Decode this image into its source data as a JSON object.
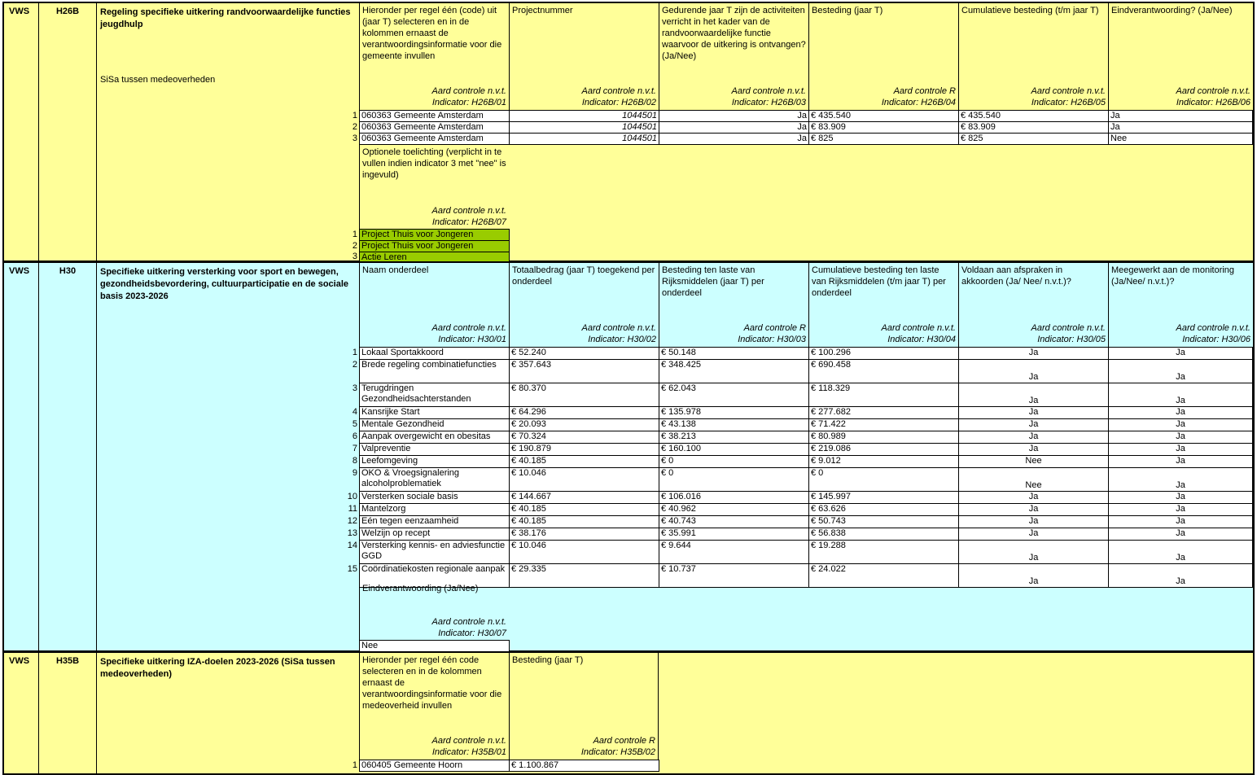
{
  "h26b": {
    "dept": "VWS",
    "code": "H26B",
    "title": "Regeling specifieke uitkering randvoorwaardelijke functies jeugdhulp",
    "subtitle": "SiSa tussen medeoverheden",
    "headers": [
      {
        "text": "Hieronder per regel één (code) uit (jaar T) selecteren en in de kolommen ernaast de verantwoordingsinformatie voor die gemeente invullen",
        "control": "Aard controle n.v.t.",
        "indicator": "Indicator: H26B/01"
      },
      {
        "text": "Projectnummer",
        "control": "Aard controle n.v.t.",
        "indicator": "Indicator: H26B/02"
      },
      {
        "text": "Gedurende jaar T zijn de activiteiten verricht in het kader van de randvoorwaardelijke functie waarvoor de uitkering is ontvangen? (Ja/Nee)",
        "control": "Aard controle n.v.t.",
        "indicator": "Indicator: H26B/03"
      },
      {
        "text": "Besteding (jaar T)",
        "control": "Aard controle R",
        "indicator": "Indicator: H26B/04"
      },
      {
        "text": "Cumulatieve besteding (t/m jaar T)",
        "control": "Aard controle n.v.t.",
        "indicator": "Indicator: H26B/05"
      },
      {
        "text": "Eindverantwoording? (Ja/Nee)",
        "control": "Aard controle n.v.t.",
        "indicator": "Indicator: H26B/06"
      }
    ],
    "rows": [
      {
        "n": "1",
        "gemeente": "060363 Gemeente Amsterdam",
        "project": "1044501",
        "activ": "Ja",
        "besteding": "€ 435.540",
        "cumulatief": "€ 435.540",
        "eind": "Ja"
      },
      {
        "n": "2",
        "gemeente": "060363 Gemeente Amsterdam",
        "project": "1044501",
        "activ": "Ja",
        "besteding": "€ 83.909",
        "cumulatief": "€ 83.909",
        "eind": "Ja"
      },
      {
        "n": "3",
        "gemeente": "060363 Gemeente Amsterdam",
        "project": "1044501",
        "activ": "Ja",
        "besteding": "€ 825",
        "cumulatief": "€ 825",
        "eind": "Nee"
      }
    ],
    "toelichting": {
      "text": "Optionele toelichting (verplicht in te vullen indien indicator 3 met \"nee\" is ingevuld)",
      "control": "Aard controle n.v.t.",
      "indicator": "Indicator: H26B/07"
    },
    "toelichting_rows": [
      {
        "n": "1",
        "text": "Project Thuis voor Jongeren"
      },
      {
        "n": "2",
        "text": "Project Thuis voor Jongeren"
      },
      {
        "n": "3",
        "text": "Actie Leren"
      }
    ]
  },
  "h30": {
    "dept": "VWS",
    "code": "H30",
    "title": "Specifieke uitkering versterking voor sport en bewegen, gezondheidsbevordering, cultuurparticipatie en de sociale basis 2023-2026",
    "headers": [
      {
        "text": "Naam onderdeel",
        "control": "Aard controle n.v.t.",
        "indicator": "Indicator: H30/01"
      },
      {
        "text": "Totaalbedrag (jaar T) toegekend per onderdeel",
        "control": "Aard controle n.v.t.",
        "indicator": "Indicator: H30/02"
      },
      {
        "text": "Besteding ten laste van Rijksmiddelen (jaar T) per onderdeel",
        "control": "Aard controle R",
        "indicator": "Indicator: H30/03"
      },
      {
        "text": "Cumulatieve besteding ten laste van Rijksmiddelen (t/m jaar T) per onderdeel",
        "control": "Aard controle n.v.t.",
        "indicator": "Indicator: H30/04"
      },
      {
        "text": "Voldaan aan afspraken in akkoorden (Ja/ Nee/ n.v.t.)?",
        "control": "Aard controle n.v.t.",
        "indicator": "Indicator: H30/05"
      },
      {
        "text": "Meegewerkt aan de monitoring (Ja/Nee/ n.v.t.)?",
        "control": "Aard controle n.v.t.",
        "indicator": "Indicator: H30/06"
      }
    ],
    "rows": [
      {
        "n": "1",
        "naam": "Lokaal Sportakkoord",
        "totaal": "€ 52.240",
        "besteding": "€ 50.148",
        "cumulatief": "€ 100.296",
        "voldaan": "Ja",
        "monitoring": "Ja"
      },
      {
        "n": "2",
        "naam": "Brede regeling combinatiefuncties",
        "totaal": "€ 357.643",
        "besteding": "€ 348.425",
        "cumulatief": "€ 690.458",
        "voldaan": "Ja",
        "monitoring": "Ja"
      },
      {
        "n": "3",
        "naam": "Terugdringen Gezondheidsachterstanden",
        "totaal": "€ 80.370",
        "besteding": "€ 62.043",
        "cumulatief": "€ 118.329",
        "voldaan": "Ja",
        "monitoring": "Ja"
      },
      {
        "n": "4",
        "naam": "Kansrijke Start",
        "totaal": "€ 64.296",
        "besteding": "€ 135.978",
        "cumulatief": "€ 277.682",
        "voldaan": "Ja",
        "monitoring": "Ja"
      },
      {
        "n": "5",
        "naam": "Mentale Gezondheid",
        "totaal": "€ 20.093",
        "besteding": "€ 43.138",
        "cumulatief": "€ 71.422",
        "voldaan": "Ja",
        "monitoring": "Ja"
      },
      {
        "n": "6",
        "naam": "Aanpak overgewicht en obesitas",
        "totaal": "€ 70.324",
        "besteding": "€ 38.213",
        "cumulatief": "€ 80.989",
        "voldaan": "Ja",
        "monitoring": "Ja"
      },
      {
        "n": "7",
        "naam": "Valpreventie",
        "totaal": "€ 190.879",
        "besteding": "€ 160.100",
        "cumulatief": "€ 219.086",
        "voldaan": "Ja",
        "monitoring": "Ja"
      },
      {
        "n": "8",
        "naam": "Leefomgeving",
        "totaal": "€ 40.185",
        "besteding": "€ 0",
        "cumulatief": "€ 9.012",
        "voldaan": "Nee",
        "monitoring": "Ja"
      },
      {
        "n": "9",
        "naam": "OKO & Vroegsignalering alcoholproblematiek",
        "totaal": "€ 10.046",
        "besteding": "€ 0",
        "cumulatief": "€ 0",
        "voldaan": "Nee",
        "monitoring": "Ja"
      },
      {
        "n": "10",
        "naam": "Versterken sociale basis",
        "totaal": "€ 144.667",
        "besteding": "€ 106.016",
        "cumulatief": "€ 145.997",
        "voldaan": "Ja",
        "monitoring": "Ja"
      },
      {
        "n": "11",
        "naam": "Mantelzorg",
        "totaal": "€ 40.185",
        "besteding": "€ 40.962",
        "cumulatief": "€ 63.626",
        "voldaan": "Ja",
        "monitoring": "Ja"
      },
      {
        "n": "12",
        "naam": "Eén tegen eenzaamheid",
        "totaal": "€ 40.185",
        "besteding": "€ 40.743",
        "cumulatief": "€ 50.743",
        "voldaan": "Ja",
        "monitoring": "Ja"
      },
      {
        "n": "13",
        "naam": "Welzijn op recept",
        "totaal": "€ 38.176",
        "besteding": "€ 35.991",
        "cumulatief": "€ 56.838",
        "voldaan": "Ja",
        "monitoring": "Ja"
      },
      {
        "n": "14",
        "naam": "Versterking kennis- en adviesfunctie GGD",
        "totaal": "€ 10.046",
        "besteding": "€ 9.644",
        "cumulatief": "€ 19.288",
        "voldaan": "Ja",
        "monitoring": "Ja"
      },
      {
        "n": "15",
        "naam": "Coördinatiekosten regionale aanpak",
        "totaal": "€ 29.335",
        "besteding": "€ 10.737",
        "cumulatief": "€ 24.022",
        "voldaan": "Ja",
        "monitoring": "Ja"
      }
    ],
    "eind": {
      "text": "Eindverantwoording (Ja/Nee)",
      "control": "Aard controle n.v.t.",
      "indicator": "Indicator: H30/07",
      "value": "Nee"
    }
  },
  "h35b": {
    "dept": "VWS",
    "code": "H35B",
    "title": "Specifieke uitkering IZA-doelen 2023-2026 (SiSa tussen medeoverheden)",
    "headers": [
      {
        "text": "Hieronder per regel één code selecteren en in de kolommen ernaast de verantwoordingsinformatie voor die medeoverheid invullen",
        "control": "Aard controle n.v.t.",
        "indicator": "Indicator: H35B/01"
      },
      {
        "text": "Besteding (jaar T)",
        "control": "Aard controle R",
        "indicator": "Indicator: H35B/02"
      }
    ],
    "rows": [
      {
        "n": "1",
        "gemeente": "060405 Gemeente Hoorn",
        "besteding": "€ 1.100.867"
      }
    ]
  }
}
